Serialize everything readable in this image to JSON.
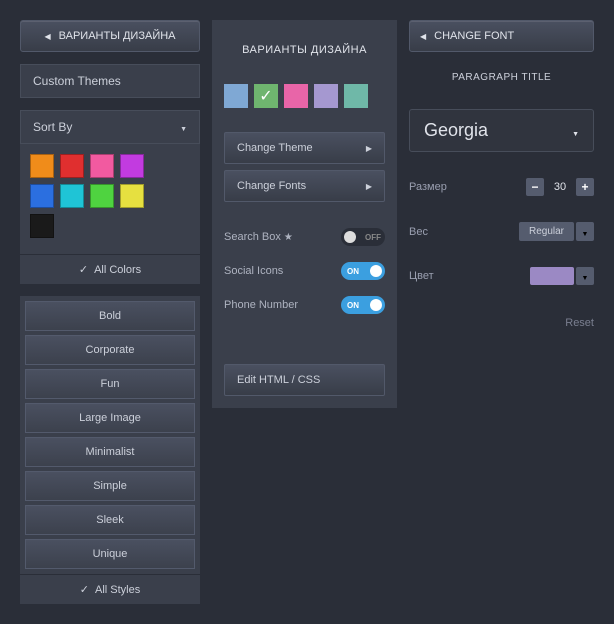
{
  "col1": {
    "designVariantsBtn": "ВАРИАНТЫ ДИЗАЙНА",
    "customThemes": "Custom Themes",
    "sortBy": "Sort By",
    "colors": {
      "row1": [
        "#f08c1a",
        "#e02f2f",
        "#f25aa0",
        "#c23be0"
      ],
      "row2": [
        "#2b6fe0",
        "#1fc4d6",
        "#4fd340",
        "#e6e040"
      ],
      "row3": [
        "#1a1a1a"
      ]
    },
    "allColors": "All Colors",
    "styles": [
      "Bold",
      "Corporate",
      "Fun",
      "Large Image",
      "Minimalist",
      "Simple",
      "Sleek",
      "Unique"
    ],
    "allStyles": "All Styles"
  },
  "col2": {
    "title": "ВАРИАНТЫ ДИЗАЙНА",
    "themeColors": [
      "#7fa8d4",
      "#6fb56f",
      "#e865a8",
      "#a598d0",
      "#6fb8a8"
    ],
    "selectedTheme": 1,
    "changeTheme": "Change Theme",
    "changeFonts": "Change Fonts",
    "toggles": [
      {
        "label": "Search Box",
        "star": true,
        "state": "off",
        "text": "OFF"
      },
      {
        "label": "Social Icons",
        "star": false,
        "state": "on",
        "text": "ON"
      },
      {
        "label": "Phone Number",
        "star": false,
        "state": "on",
        "text": "ON"
      }
    ],
    "editHtml": "Edit HTML / CSS"
  },
  "col3": {
    "changeFontBtn": "CHANGE FONT",
    "paragraphTitle": "PARAGRAPH TITLE",
    "fontName": "Georgia",
    "sizeLabel": "Размер",
    "sizeValue": "30",
    "weightLabel": "Вес",
    "weightValue": "Regular",
    "colorLabel": "Цвет",
    "colorValue": "#9b89c4",
    "reset": "Reset"
  }
}
